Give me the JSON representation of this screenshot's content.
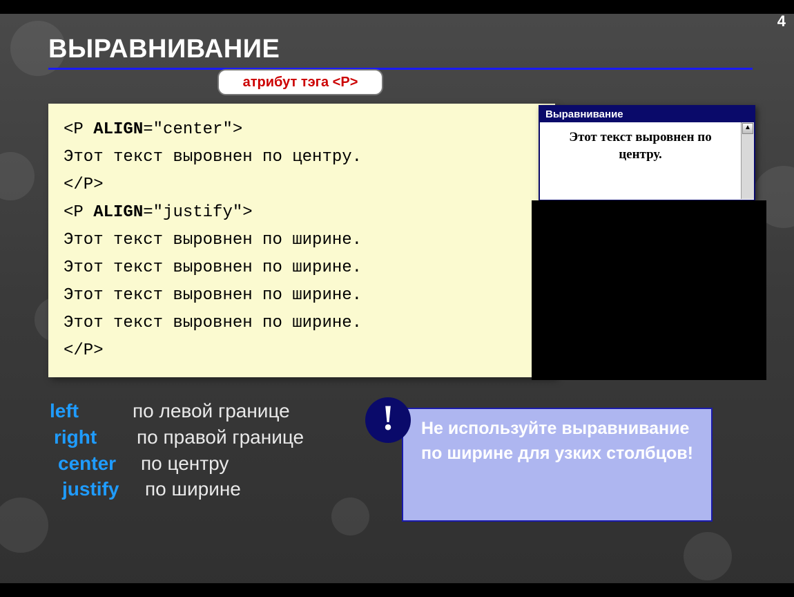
{
  "slide_number": "4",
  "title": "ВЫРАВНИВАНИЕ",
  "callout": "атрибут тэга <P>",
  "code_lines": [
    {
      "pre": "<P ",
      "b": "ALIGN",
      "post": "=\"center\">"
    },
    {
      "pre": "Этот текст выровнен по центру.",
      "b": "",
      "post": ""
    },
    {
      "pre": "</P>",
      "b": "",
      "post": ""
    },
    {
      "pre": "<P ",
      "b": "ALIGN",
      "post": "=\"justify\">"
    },
    {
      "pre": "Этот текст выровнен по ширине.",
      "b": "",
      "post": ""
    },
    {
      "pre": "Этот текст выровнен по ширине.",
      "b": "",
      "post": ""
    },
    {
      "pre": "Этот текст выровнен по ширине.",
      "b": "",
      "post": ""
    },
    {
      "pre": "Этот текст выровнен по ширине.",
      "b": "",
      "post": ""
    },
    {
      "pre": "</P>",
      "b": "",
      "post": ""
    }
  ],
  "window": {
    "title": "Выравнивание",
    "body": "Этот текст выровнен по центру."
  },
  "options": [
    {
      "kw": "left",
      "desc": "по левой границе"
    },
    {
      "kw": "right",
      "desc": "по правой границе"
    },
    {
      "kw": "center",
      "desc": "по центру"
    },
    {
      "kw": "justify",
      "desc": "по ширине"
    }
  ],
  "bang": "!",
  "note": "Не используйте выравнивание по ширине для узких столбцов!"
}
